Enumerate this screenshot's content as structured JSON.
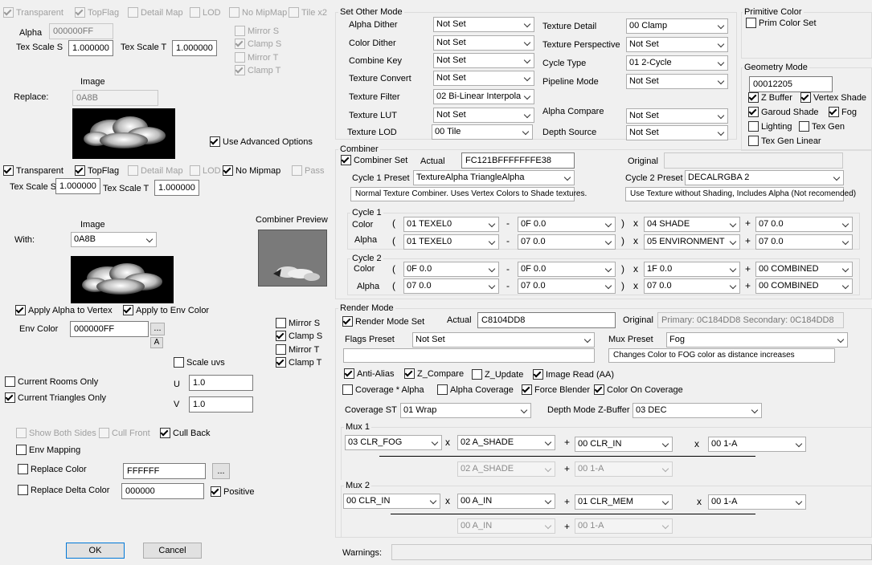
{
  "left": {
    "top_flags": {
      "transparent": "Transparent",
      "topflag": "TopFlag",
      "detail_map": "Detail Map",
      "lod": "LOD",
      "no_mipmap": "No MipMap",
      "tile_x2": "Tile x2"
    },
    "alpha_label": "Alpha",
    "alpha_value": "000000FF",
    "tex_scale_s_label": "Tex Scale S",
    "tex_scale_s_value": "1.000000",
    "tex_scale_t_label": "Tex Scale T",
    "tex_scale_t_value": "1.000000",
    "mirror_s": "Mirror S",
    "clamp_s": "Clamp S",
    "mirror_t": "Mirror T",
    "clamp_t": "Clamp T",
    "image_label": "Image",
    "replace_label": "Replace:",
    "replace_value": "0A8B",
    "use_advanced": "Use Advanced Options",
    "flags2": {
      "transparent": "Transparent",
      "topflag": "TopFlag",
      "detail_map": "Detail Map",
      "lod": "LOD",
      "no_mipmap": "No Mipmap",
      "pass": "Pass"
    },
    "tex_scale_s2_label": "Tex Scale S",
    "tex_scale_s2_value": "1.000000",
    "tex_scale_t2_label": "Tex Scale T",
    "tex_scale_t2_value": "1.000000",
    "image2_label": "Image",
    "with_label": "With:",
    "with_value": "0A8B",
    "combiner_preview": "Combiner Preview",
    "apply_alpha_vertex": "Apply Alpha to Vertex",
    "apply_env_color": "Apply to Env Color",
    "env_color_label": "Env Color",
    "env_color_value": "000000FF",
    "dots": "...",
    "a_btn": "A",
    "mirror_s2": "Mirror S",
    "clamp_s2": "Clamp S",
    "mirror_t2": "Mirror T",
    "clamp_t2": "Clamp T",
    "scale_uvs": "Scale uvs",
    "u_label": "U",
    "u_value": "1.0",
    "v_label": "V",
    "v_value": "1.0",
    "current_rooms": "Current Rooms Only",
    "current_triangles": "Current Triangles Only",
    "show_both_sides": "Show Both Sides",
    "cull_front": "Cull Front",
    "cull_back": "Cull Back",
    "env_mapping": "Env Mapping",
    "replace_color": "Replace Color",
    "replace_color_value": "FFFFFF",
    "replace_delta": "Replace Delta Color",
    "replace_delta_value": "000000",
    "positive": "Positive",
    "ok": "OK",
    "cancel": "Cancel"
  },
  "other_mode": {
    "title": "Set Other Mode",
    "rows_left": [
      {
        "label": "Alpha Dither",
        "value": "Not Set"
      },
      {
        "label": "Color Dither",
        "value": "Not Set"
      },
      {
        "label": "Combine Key",
        "value": "Not Set"
      },
      {
        "label": "Texture Convert",
        "value": "Not Set"
      },
      {
        "label": "Texture Filter",
        "value": "02 Bi-Linear Interpola"
      },
      {
        "label": "Texture LUT",
        "value": "Not Set"
      },
      {
        "label": "Texture LOD",
        "value": "00 Tile"
      }
    ],
    "rows_right": [
      {
        "label": "Texture Detail",
        "value": "00 Clamp"
      },
      {
        "label": "Texture Perspective",
        "value": "Not Set"
      },
      {
        "label": "Cycle Type",
        "value": "01 2-Cycle"
      },
      {
        "label": "Pipeline Mode",
        "value": "Not Set"
      },
      {
        "label": "Alpha Compare",
        "value": "Not Set"
      },
      {
        "label": "Depth Source",
        "value": "Not Set"
      }
    ]
  },
  "primitive": {
    "title": "Primitive Color",
    "prim_color_set": "Prim Color Set"
  },
  "geometry": {
    "title": "Geometry Mode",
    "value": "00012205",
    "z_buffer": "Z Buffer",
    "vertex_shade": "Vertex Shade",
    "garoud_shade": "Garoud Shade",
    "fog": "Fog",
    "lighting": "Lighting",
    "tex_gen": "Tex Gen",
    "tex_gen_linear": "Tex Gen Linear"
  },
  "combiner": {
    "title": "Combiner",
    "combiner_set": "Combiner Set",
    "actual_label": "Actual",
    "actual_value": "FC121BFFFFFFFE38",
    "original_label": "Original",
    "original_value": "",
    "cycle1_preset_label": "Cycle 1 Preset",
    "cycle1_preset": "TextureAlpha TriangleAlpha",
    "cycle1_desc": "Normal Texture Combiner. Uses Vertex Colors to Shade textures.",
    "cycle2_preset_label": "Cycle 2 Preset",
    "cycle2_preset": "DECALRGBA 2",
    "cycle2_desc": "Use Texture without Shading, Includes Alpha (Not recomended)",
    "cycle1": {
      "title": "Cycle 1",
      "color_label": "Color",
      "alpha_label": "Alpha",
      "color": [
        "01 TEXEL0",
        "0F 0.0",
        "04 SHADE",
        "07 0.0"
      ],
      "alpha": [
        "01 TEXEL0",
        "07 0.0",
        "05 ENVIRONMENT",
        "07 0.0"
      ]
    },
    "cycle2": {
      "title": "Cycle 2",
      "color_label": "Color",
      "alpha_label": "Alpha",
      "color": [
        "0F 0.0",
        "0F 0.0",
        "1F 0.0",
        "00 COMBINED"
      ],
      "alpha": [
        "07 0.0",
        "07 0.0",
        "07 0.0",
        "00 COMBINED"
      ]
    },
    "ops": {
      "open": "(",
      "minus": "-",
      "close": ")",
      "times": "x",
      "plus": "+"
    }
  },
  "render_mode": {
    "title": "Render Mode",
    "render_mode_set": "Render Mode Set",
    "actual_label": "Actual",
    "actual_value": "C8104DD8",
    "original_label": "Original",
    "original_value": "Primary: 0C184DD8 Secondary: 0C184DD8",
    "flags_preset_label": "Flags Preset",
    "flags_preset": "Not Set",
    "flags_desc": "",
    "mux_preset_label": "Mux Preset",
    "mux_preset": "Fog",
    "mux_desc": "Changes Color to FOG color as distance increases",
    "anti_alias": "Anti-Alias",
    "z_compare": "Z_Compare",
    "z_update": "Z_Update",
    "image_read": "Image Read (AA)",
    "coverage_alpha": "Coverage * Alpha",
    "alpha_coverage": "Alpha Coverage",
    "force_blender": "Force Blender",
    "color_on_coverage": "Color On Coverage",
    "coverage_st_label": "Coverage ST",
    "coverage_st": "01 Wrap",
    "depth_mode_label": "Depth Mode Z-Buffer",
    "depth_mode": "03 DEC",
    "mux1": {
      "title": "Mux 1",
      "a": "03 CLR_FOG",
      "b": "02 A_SHADE",
      "c": "00 CLR_IN",
      "d": "00 1-A",
      "e": "02 A_SHADE",
      "f": "00 1-A"
    },
    "mux2": {
      "title": "Mux 2",
      "a": "00 CLR_IN",
      "b": "00 A_IN",
      "c": "01 CLR_MEM",
      "d": "00 1-A",
      "e": "00 A_IN",
      "f": "00 1-A"
    }
  },
  "warnings_label": "Warnings:",
  "warnings_value": ""
}
